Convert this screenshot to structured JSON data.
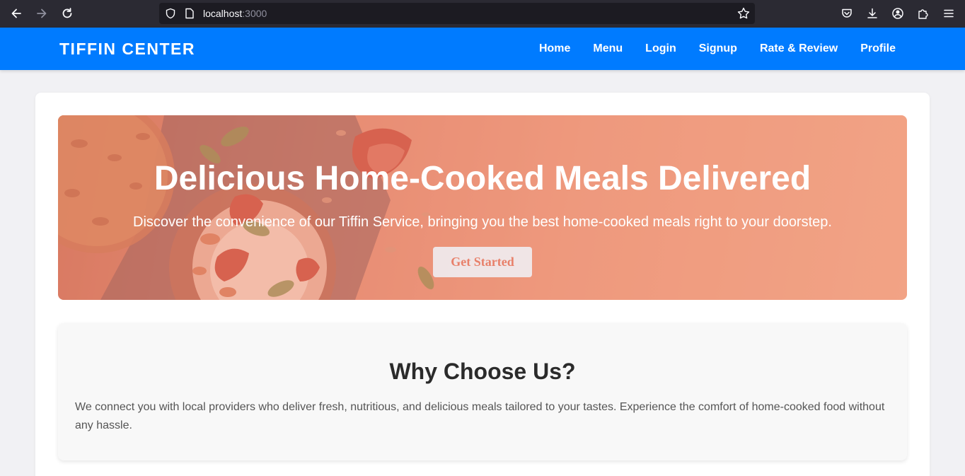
{
  "browser": {
    "url_host": "localhost",
    "url_port": ":3000"
  },
  "site": {
    "brand": "TIFFIN CENTER",
    "nav": [
      {
        "label": "Home"
      },
      {
        "label": "Menu"
      },
      {
        "label": "Login"
      },
      {
        "label": "Signup"
      },
      {
        "label": "Rate & Review"
      },
      {
        "label": "Profile"
      }
    ],
    "brand_color": "#007bff"
  },
  "hero": {
    "title": "Delicious Home-Cooked Meals Delivered",
    "subtitle": "Discover the convenience of our Tiffin Service, bringing you the best home-cooked meals right to your doorstep.",
    "cta_label": "Get Started"
  },
  "why": {
    "title": "Why Choose Us?",
    "body": "We connect you with local providers who deliver fresh, nutritious, and delicious meals tailored to your tastes. Experience the comfort of home-cooked food without any hassle."
  }
}
